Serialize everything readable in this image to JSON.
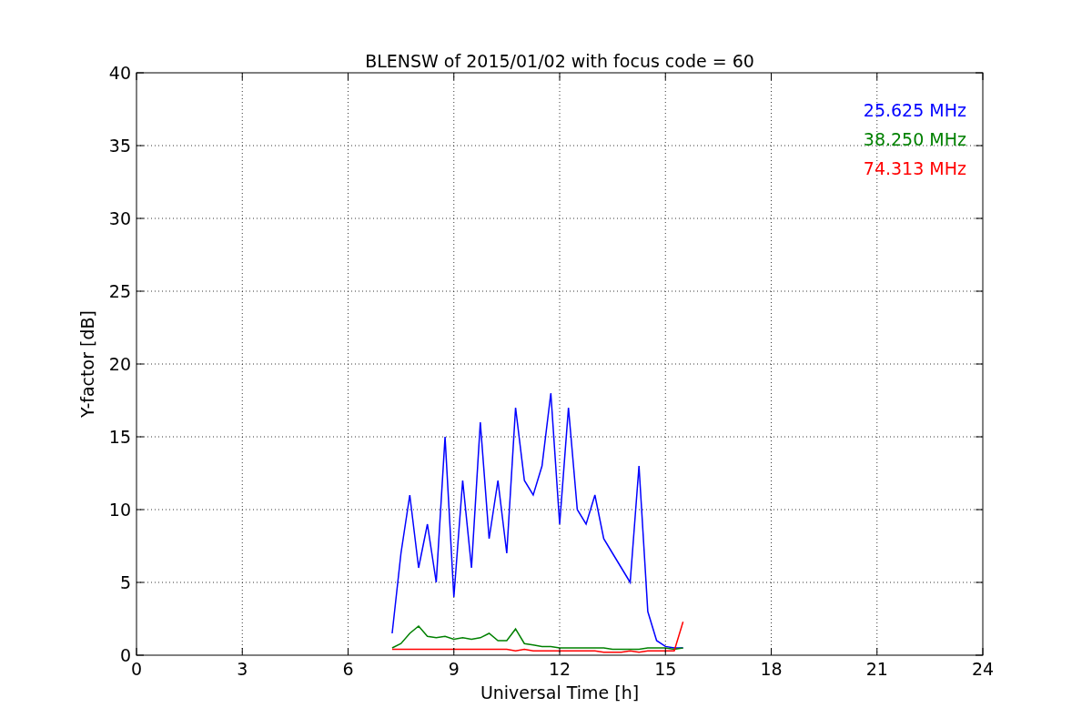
{
  "chart_data": {
    "type": "line",
    "title": "BLENSW of 2015/01/02 with focus code = 60",
    "xlabel": "Universal Time [h]",
    "ylabel": "Y-factor [dB]",
    "x": [
      7.25,
      7.5,
      7.75,
      8,
      8.25,
      8.5,
      8.75,
      9,
      9.25,
      9.5,
      9.75,
      10,
      10.25,
      10.5,
      10.75,
      11,
      11.25,
      11.5,
      11.75,
      12,
      12.25,
      12.5,
      12.75,
      13,
      13.25,
      13.5,
      13.75,
      14,
      14.25,
      14.5,
      14.75,
      15,
      15.25,
      15.5
    ],
    "series": [
      {
        "name": "25.625 MHz",
        "color": "#0000ff",
        "values": [
          1.5,
          7,
          11,
          6,
          9,
          5,
          15,
          4,
          12,
          6,
          16,
          8,
          12,
          7,
          17,
          12,
          11,
          13,
          18,
          9,
          17,
          10,
          9,
          11,
          8,
          7,
          6,
          5,
          13,
          3,
          1,
          0.6,
          0.5,
          0.5
        ]
      },
      {
        "name": "38.250 MHz",
        "color": "#008000",
        "values": [
          0.5,
          0.8,
          1.5,
          2,
          1.3,
          1.2,
          1.3,
          1.1,
          1.2,
          1.1,
          1.2,
          1.5,
          1,
          1,
          1.8,
          0.8,
          0.7,
          0.6,
          0.6,
          0.5,
          0.5,
          0.5,
          0.5,
          0.5,
          0.5,
          0.4,
          0.4,
          0.4,
          0.4,
          0.5,
          0.5,
          0.5,
          0.4,
          0.5
        ]
      },
      {
        "name": "74.313 MHz",
        "color": "#ff0000",
        "values": [
          0.4,
          0.4,
          0.4,
          0.4,
          0.4,
          0.4,
          0.4,
          0.4,
          0.4,
          0.4,
          0.4,
          0.4,
          0.4,
          0.4,
          0.3,
          0.4,
          0.3,
          0.3,
          0.3,
          0.3,
          0.3,
          0.3,
          0.3,
          0.3,
          0.2,
          0.2,
          0.2,
          0.3,
          0.2,
          0.3,
          0.3,
          0.3,
          0.3,
          2.3
        ]
      }
    ],
    "grid": true,
    "xlim": [
      0,
      24
    ],
    "ylim": [
      0,
      40
    ],
    "xticks": [
      0,
      3,
      6,
      9,
      12,
      15,
      18,
      21,
      24
    ],
    "yticks": [
      0,
      5,
      10,
      15,
      20,
      25,
      30,
      35,
      40
    ]
  }
}
